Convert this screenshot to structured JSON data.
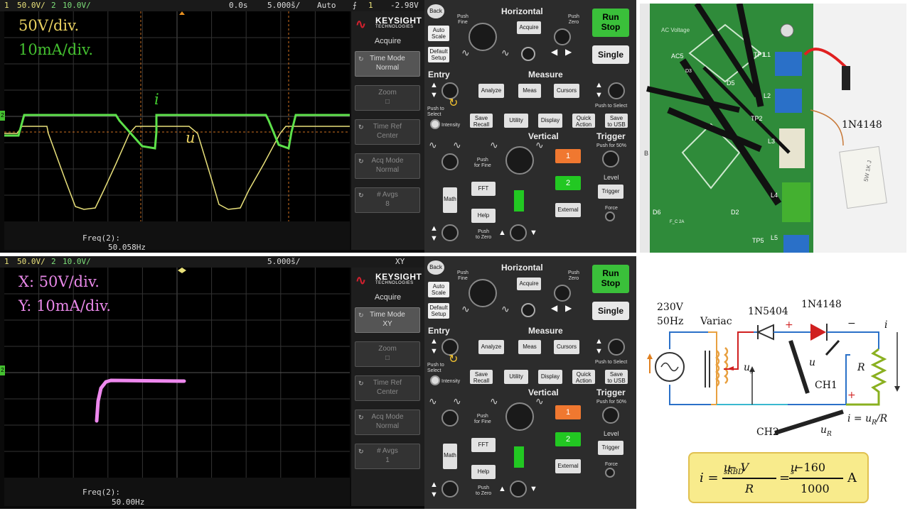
{
  "top_scope": {
    "status": {
      "ch1_num": "1",
      "ch1_scale": "50.0V/",
      "ch2_num": "2",
      "ch2_scale": "10.0V/",
      "delay": "0.0s",
      "timebase": "5.000š/",
      "trigger_mode": "Auto",
      "trig_num": "1",
      "trig_level": "-2.98V"
    },
    "label_v": "50V/div.",
    "label_i": "10mA/div.",
    "trace_i_label": "i",
    "trace_u_label": "u",
    "freq_label": "Freq(2):",
    "freq_value": "50.058Hz",
    "menu": {
      "brand_name": "KEYSIGHT",
      "brand_sub": "TECHNOLOGIES",
      "title": "Acquire",
      "keys": [
        {
          "label": "Time Mode",
          "value": "Normal"
        },
        {
          "label": "Zoom",
          "value": "□"
        },
        {
          "label": "Time Ref",
          "value": "Center"
        },
        {
          "label": "Acq Mode",
          "value": "Normal"
        },
        {
          "label": "# Avgs",
          "value": "8"
        }
      ]
    }
  },
  "bottom_scope": {
    "status": {
      "ch1_num": "1",
      "ch1_scale": "50.0V/",
      "ch2_num": "2",
      "ch2_scale": "10.0V/",
      "timebase": "5.000š/",
      "mode": "XY"
    },
    "label_x": "X: 50V/div.",
    "label_y": "Y: 10mA/div.",
    "freq_label": "Freq(2):",
    "freq_value": "50.00Hz",
    "menu": {
      "brand_name": "KEYSIGHT",
      "brand_sub": "TECHNOLOGIES",
      "title": "Acquire",
      "keys": [
        {
          "label": "Time Mode",
          "value": "XY"
        },
        {
          "label": "Zoom",
          "value": "□"
        },
        {
          "label": "Time Ref",
          "value": "Center"
        },
        {
          "label": "Acq Mode",
          "value": "Normal"
        },
        {
          "label": "# Avgs",
          "value": "1"
        }
      ]
    }
  },
  "panel": {
    "back": "Back",
    "horizontal": "Horizontal",
    "push_fine": "Push\nFine",
    "push_zero": "Push\nZero",
    "acquire": "Acquire",
    "run_stop_1": "Run",
    "run_stop_2": "Stop",
    "single": "Single",
    "auto_scale": "Auto\nScale",
    "default_setup": "Default\nSetup",
    "entry": "Entry",
    "push_to_select": "Push to\nSelect",
    "intensity": "Intensity",
    "measure": "Measure",
    "analyze": "Analyze",
    "meas": "Meas",
    "cursors": "Cursors",
    "cursors_push": "Push to Select",
    "save_recall": "Save\nRecall",
    "utility": "Utility",
    "display": "Display",
    "quick_action": "Quick\nAction",
    "save_usb": "Save\nto USB",
    "vertical": "Vertical",
    "trigger": "Trigger",
    "push_50": "Push for 50%",
    "level": "Level",
    "trigger_btn": "Trigger",
    "force": "Force",
    "push_for_fine": "Push\nfor Fine",
    "fft": "FFT",
    "ch1_btn": "1",
    "ch2_btn": "2",
    "math": "Math",
    "help": "Help",
    "external": "External",
    "push_to_zero": "Push\nto Zero"
  },
  "photo": {
    "board_text": "AC Voltage",
    "part_label": "1N4148",
    "resistor_text": "5W 1K J",
    "silk": [
      "TP1",
      "L1",
      "L2",
      "TP2",
      "L3",
      "L4",
      "L5",
      "TP5",
      "D6",
      "D2",
      "D5",
      "D3",
      "B",
      "F_C 2A",
      "AC5"
    ]
  },
  "circuit": {
    "source_v": "230V",
    "source_f": "50Hz",
    "variac": "Variac",
    "d1": "1N5404",
    "d2": "1N4148",
    "plus1": "+",
    "minus1": "−",
    "current": "i",
    "us": "u",
    "us_sub": "s",
    "u": "u",
    "r": "R",
    "ch1": "CH1",
    "ch2": "CH2",
    "plus2": "+",
    "ur": "u",
    "ur_sub": "R",
    "i_eq": "i = u",
    "i_eq_sub": "R",
    "i_eq_tail": "/R"
  },
  "formula": {
    "lhs": "i =",
    "num1": "u",
    "num1_sub": "s",
    "num1_mid": " − V",
    "num1_sub2": "RBD",
    "den1": "R",
    "eq": "=",
    "num2": "u",
    "num2_sub": "s",
    "num2_tail": " −160",
    "den2": "1000",
    "unit": "A"
  },
  "colors": {
    "ch1_trace": "#e8e07a",
    "ch2_trace": "#5de04a",
    "xy_trace": "#ee88ee",
    "grid": "#3a3a3a",
    "run_stop": "#3ac03a",
    "ch1_btn": "#f07830",
    "ch2_btn": "#22c822"
  }
}
